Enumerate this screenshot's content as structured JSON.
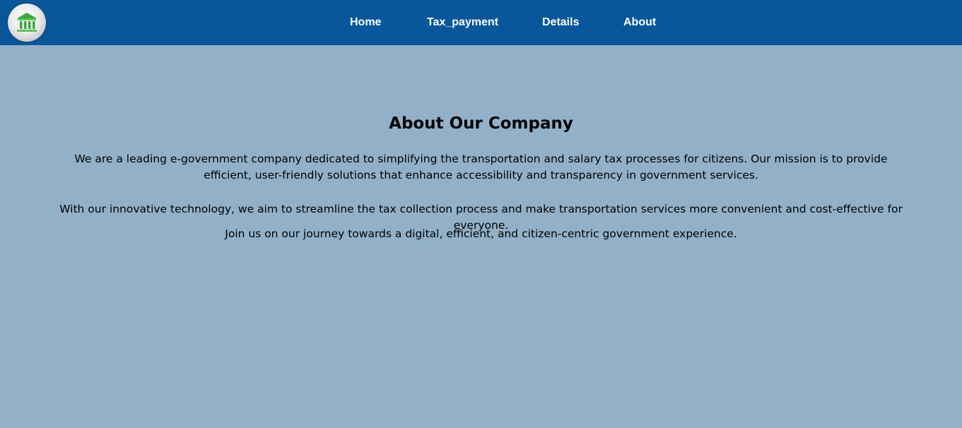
{
  "header": {
    "logo_icon": "bank-building-icon",
    "nav": {
      "home": "Home",
      "tax_payment": "Tax_payment",
      "details": "Details",
      "about": "About"
    }
  },
  "main": {
    "title": "About Our Company",
    "paragraphs": [
      "We are a leading e-government company dedicated to simplifying the transportation and salary tax processes for citizens. Our mission is to provide efficient, user-friendly solutions that enhance accessibility and transparency in government services.",
      "With our innovative technology, we aim to streamline the tax collection process and make transportation services more convenient and cost-effective for everyone.",
      "Join us on our journey towards a digital, efficient, and citizen-centric government experience."
    ]
  },
  "colors": {
    "navbar": "#08579b",
    "background": "#92b1c9",
    "logo_accent": "#3aa83a"
  }
}
